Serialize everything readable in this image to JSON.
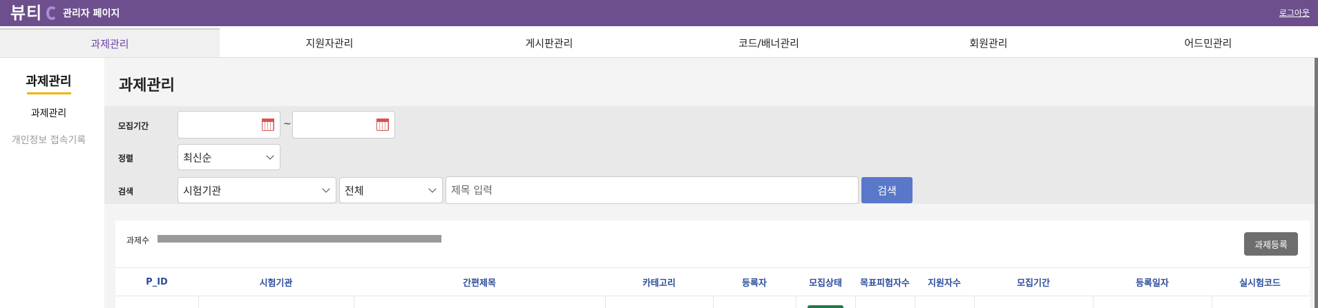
{
  "header": {
    "logo": "뷰티",
    "title": "관리자 페이지",
    "logout": "로그아웃"
  },
  "tabs": [
    {
      "label": "과제관리",
      "active": true
    },
    {
      "label": "지원자관리"
    },
    {
      "label": "게시판관리"
    },
    {
      "label": "코드/배너관리"
    },
    {
      "label": "회원관리"
    },
    {
      "label": "어드민관리"
    }
  ],
  "sidebar": {
    "title": "과제관리",
    "items": [
      {
        "label": "과제관리",
        "active": true
      },
      {
        "label": "개인정보 접속기록"
      }
    ]
  },
  "main": {
    "title": "과제관리",
    "filters": {
      "period_label": "모집기간",
      "start_date": "",
      "end_date": "",
      "tilde": "~",
      "sort_label": "정렬",
      "sort_value": "최신순",
      "search_label": "검색",
      "search_field": "시험기관",
      "search_scope": "전체",
      "search_placeholder": "제목 입력",
      "search_button": "검색"
    },
    "list": {
      "count_label": "과제수",
      "register_button": "과제등록",
      "columns": [
        "P_ID",
        "시험기관",
        "간편제목",
        "카테고리",
        "등록자",
        "모집상태",
        "목표피험자수",
        "지원자수",
        "모집기간",
        "등록일자",
        "실시험코드"
      ]
    }
  },
  "colors": {
    "header_bg": "#6c4f8c",
    "active_tab_text": "#6c3fa7",
    "search_button": "#5a78c9",
    "register_button": "#6e6e6e",
    "column_header_text": "#2b4d9a",
    "status_green": "#1f7a44"
  }
}
